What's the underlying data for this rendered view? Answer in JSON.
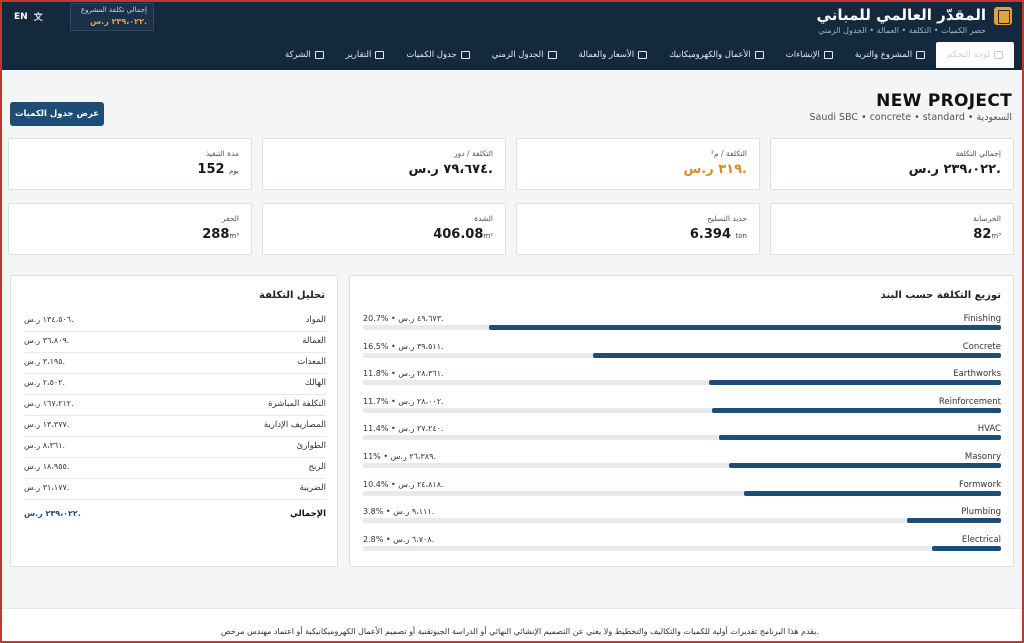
{
  "app": {
    "title": "المقدّر العالمي للمباني",
    "subtitle": "حصر الكميات • التكلفة • العمالة • الجدول الزمني",
    "lang": "EN",
    "total_label": "إجمالي تكلفة المشروع",
    "total_value": "٢٣٩،٠٢٢ ر.س."
  },
  "nav": {
    "tabs": [
      {
        "label": "لوحة التحكم",
        "active": true
      },
      {
        "label": "المشروع والتربة"
      },
      {
        "label": "الإنشاءات"
      },
      {
        "label": "الأعمال والكهروميكانيك"
      },
      {
        "label": "الأسعار والعمالة"
      },
      {
        "label": "الجدول الزمني"
      },
      {
        "label": "جدول الكميات"
      },
      {
        "label": "التقارير"
      },
      {
        "label": "الشركة"
      }
    ]
  },
  "project": {
    "name": "NEW PROJECT",
    "subtitle": "Saudi SBC • concrete • standard • السعودية",
    "boq_button": "عرض جدول الكميات"
  },
  "stats": [
    {
      "label": "إجمالي التكلفة",
      "value": "٢٣٩،٠٢٢ ر.س.",
      "unit": ""
    },
    {
      "label": "التكلفة / م²",
      "value": "٣١٩ ر.س.",
      "unit": "",
      "accent": true
    },
    {
      "label": "التكلفة / دور",
      "value": "٧٩،٦٧٤ ر.س.",
      "unit": ""
    },
    {
      "label": "مدة التنفيذ",
      "value": "152",
      "unit": "يوم"
    },
    {
      "label": "الخرسانة",
      "value": "82",
      "unit": "m³"
    },
    {
      "label": "حديد التسليح",
      "value": "6.394",
      "unit": "ton"
    },
    {
      "label": "الشدة",
      "value": "406.08",
      "unit": "m²"
    },
    {
      "label": "الحفر",
      "value": "288",
      "unit": "m³"
    }
  ],
  "distribution": {
    "title": "توزيع التكلفة حسب البند",
    "items": [
      {
        "name": "Finishing",
        "amount": "٤٩،٦٧٣ ر.س.",
        "pct": "20.7%",
        "pct_value": 20.7
      },
      {
        "name": "Concrete",
        "amount": "٣٩،٥١١ ر.س.",
        "pct": "16.5%",
        "pct_value": 16.5
      },
      {
        "name": "Earthworks",
        "amount": "٢٨،٣٦١ ر.س.",
        "pct": "11.8%",
        "pct_value": 11.8
      },
      {
        "name": "Reinforcement",
        "amount": "٢٨،٠٠٢ ر.س.",
        "pct": "11.7%",
        "pct_value": 11.7
      },
      {
        "name": "HVAC",
        "amount": "٢٧،٢٤٠ ر.س.",
        "pct": "11.4%",
        "pct_value": 11.4
      },
      {
        "name": "Masonry",
        "amount": "٢٦،٣٨٩ ر.س.",
        "pct": "11%",
        "pct_value": 11.0
      },
      {
        "name": "Formwork",
        "amount": "٢٤،٨١٨ ر.س.",
        "pct": "10.4%",
        "pct_value": 10.4
      },
      {
        "name": "Plumbing",
        "amount": "٩،١١١ ر.س.",
        "pct": "3.8%",
        "pct_value": 3.8
      },
      {
        "name": "Electrical",
        "amount": "٦،٧٠٨ ر.س.",
        "pct": "2.8%",
        "pct_value": 2.8
      }
    ]
  },
  "cost_analysis": {
    "title": "تحليل التكلفة",
    "rows": [
      {
        "label": "المواد",
        "value": "١٣٤،٥٠٦ ر.س."
      },
      {
        "label": "العمالة",
        "value": "٣٦،٨٠٩ ر.س."
      },
      {
        "label": "المعدات",
        "value": "٣،١٩٥ ر.س."
      },
      {
        "label": "الهالك",
        "value": "٢،٥٠٢ ر.س."
      },
      {
        "label": "التكلفة المباشرة",
        "value": "١٦٧،٢١٢ ر.س."
      },
      {
        "label": "المصاريف الإدارية",
        "value": "١٣،٣٧٧ ر.س."
      },
      {
        "label": "الطوارئ",
        "value": "٨،٣٦١ ر.س."
      },
      {
        "label": "الربح",
        "value": "١٨،٩٥٥ ر.س."
      },
      {
        "label": "الضريبة",
        "value": "٣١،١٧٧ ر.س."
      }
    ],
    "total_label": "الإجمالي",
    "total_value": "٢٣٩،٠٢٢ ر.س."
  },
  "footer": {
    "disclaimer": "يقدم هذا البرنامج تقديرات أولية للكميات والتكاليف والتخطيط ولا يغني عن التصميم الإنشائي النهائي أو الدراسة الجيوتقنية أو تصميم الأعمال الكهروميكانيكية أو اعتماد مهندس مرخص."
  },
  "colors": {
    "header": "#14293d",
    "accent": "#e1a33b",
    "bar": "#1d4c74"
  }
}
